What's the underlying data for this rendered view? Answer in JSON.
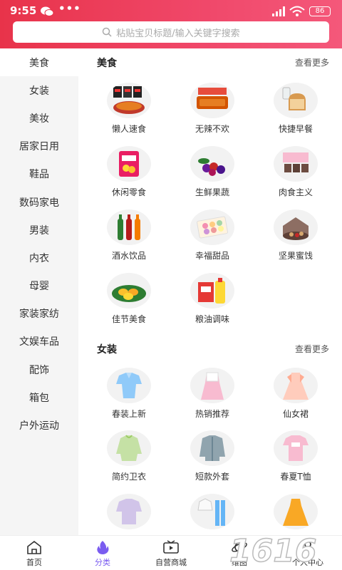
{
  "status_bar": {
    "time": "9:55",
    "dots": "•••",
    "battery": "86"
  },
  "search": {
    "placeholder": "粘贴宝贝标题/输入关键字搜索"
  },
  "sidebar": {
    "items": [
      {
        "label": "美食",
        "active": true
      },
      {
        "label": "女装"
      },
      {
        "label": "美妆"
      },
      {
        "label": "居家日用"
      },
      {
        "label": "鞋品"
      },
      {
        "label": "数码家电"
      },
      {
        "label": "男装"
      },
      {
        "label": "内衣"
      },
      {
        "label": "母婴"
      },
      {
        "label": "家装家纺"
      },
      {
        "label": "文娱车品"
      },
      {
        "label": "配饰"
      },
      {
        "label": "箱包"
      },
      {
        "label": "户外运动"
      }
    ]
  },
  "sections": [
    {
      "title": "美食",
      "more": "查看更多",
      "items": [
        "懒人速食",
        "无辣不欢",
        "快捷早餐",
        "休闲零食",
        "生鲜果蔬",
        "肉食主义",
        "酒水饮品",
        "幸福甜品",
        "坚果蜜饯",
        "佳节美食",
        "粮油调味"
      ]
    },
    {
      "title": "女装",
      "more": "查看更多",
      "items": [
        "春装上新",
        "热销推荐",
        "仙女裙",
        "简约卫衣",
        "短款外套",
        "春夏T恤",
        "",
        "",
        ""
      ]
    }
  ],
  "bottom_nav": [
    {
      "label": "首页",
      "icon": "home-icon"
    },
    {
      "label": "分类",
      "icon": "flame-icon",
      "active": true
    },
    {
      "label": "自营商城",
      "icon": "tv-play-icon"
    },
    {
      "label": "维图",
      "icon": "planet-icon"
    },
    {
      "label": "个人中心",
      "icon": "user-icon"
    }
  ],
  "colors": {
    "header": "#e8334a",
    "accent": "#7a5cf0"
  },
  "watermark": "1616"
}
